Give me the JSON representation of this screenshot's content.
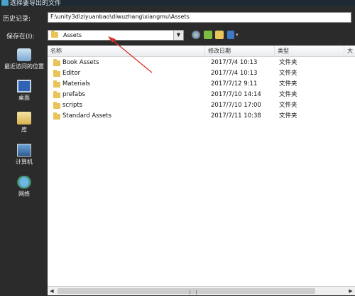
{
  "window": {
    "title": "选择要导出的文件"
  },
  "history": {
    "label": "历史记录:",
    "path": "F:\\unity3d\\ziyuanbao\\diwuzhang\\xiangmu\\Assets"
  },
  "save_in": {
    "label": "保存在(I):",
    "value": "Assets"
  },
  "places": [
    {
      "label": "最近访问的位置",
      "icon": "recent-places-icon"
    },
    {
      "label": "桌面",
      "icon": "desktop-icon"
    },
    {
      "label": "库",
      "icon": "libraries-icon"
    },
    {
      "label": "计算机",
      "icon": "computer-icon"
    },
    {
      "label": "网络",
      "icon": "network-icon"
    }
  ],
  "columns": {
    "name": "名称",
    "date": "修改日期",
    "type": "类型",
    "size": "大"
  },
  "files": [
    {
      "name": "Book Assets",
      "date": "2017/7/4 10:13",
      "type": "文件夹"
    },
    {
      "name": "Editor",
      "date": "2017/7/4 10:13",
      "type": "文件夹"
    },
    {
      "name": "Materials",
      "date": "2017/7/12 9:11",
      "type": "文件夹"
    },
    {
      "name": "prefabs",
      "date": "2017/7/10 14:14",
      "type": "文件夹"
    },
    {
      "name": "scripts",
      "date": "2017/7/10 17:00",
      "type": "文件夹"
    },
    {
      "name": "Standard Assets",
      "date": "2017/7/11 10:38",
      "type": "文件夹"
    }
  ],
  "colors": {
    "folder": "#e8c45a",
    "annotation": "#d9302a",
    "dialog_bg": "#2b2b2b"
  }
}
